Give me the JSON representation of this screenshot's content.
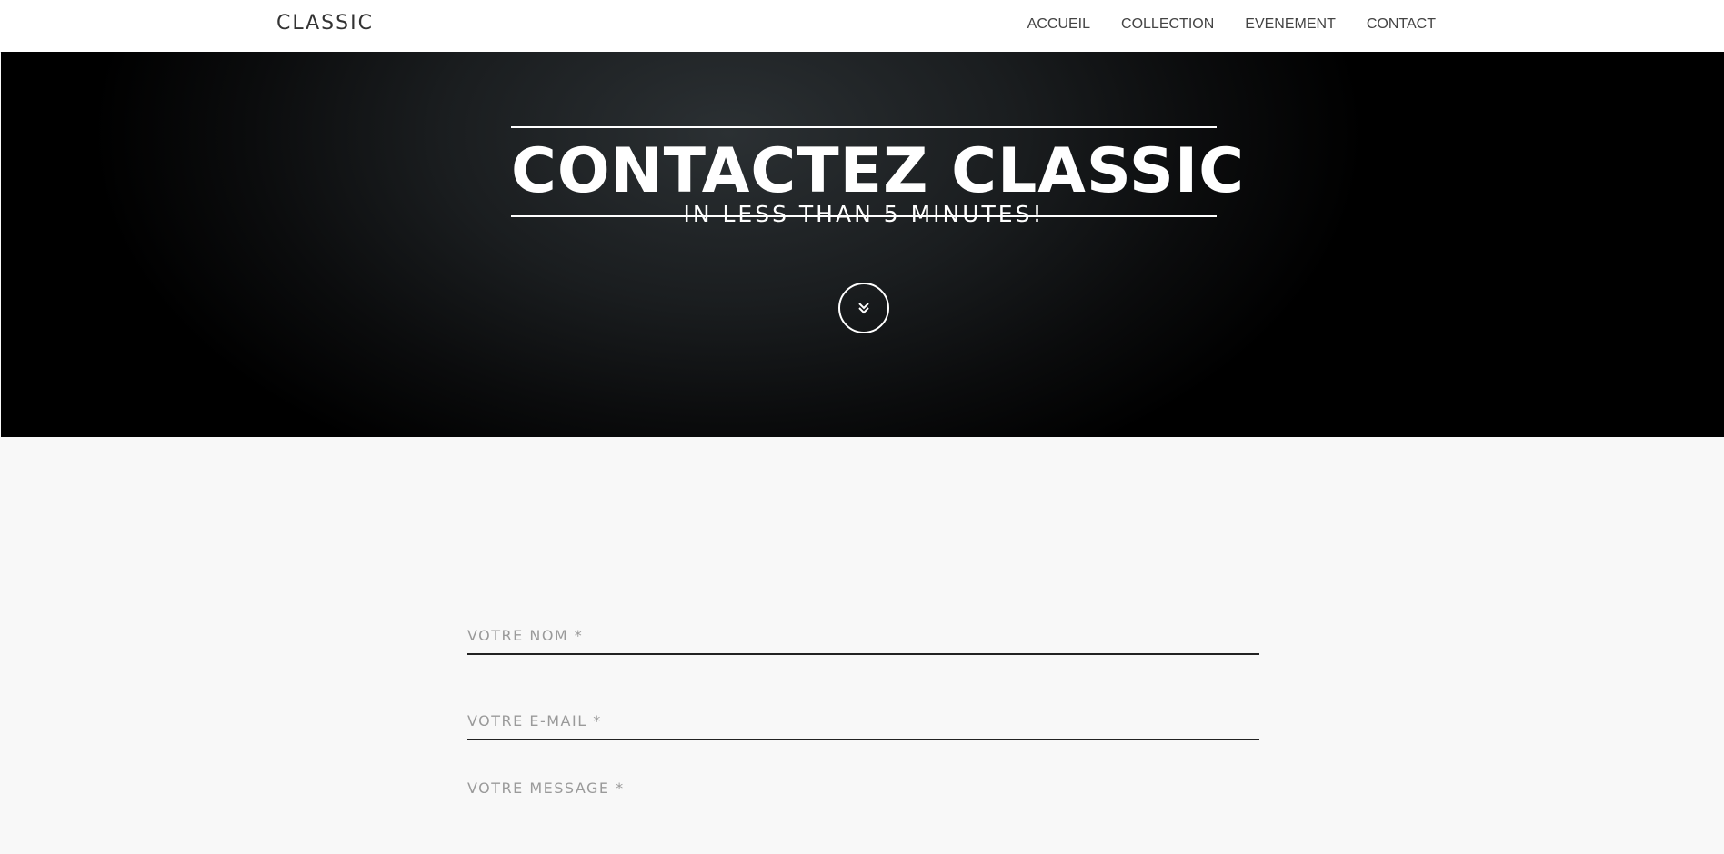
{
  "navbar": {
    "brand": "CLASSIC",
    "items": [
      {
        "label": "ACCUEIL"
      },
      {
        "label": "COLLECTION"
      },
      {
        "label": "EVENEMENT"
      },
      {
        "label": "CONTACT"
      }
    ]
  },
  "hero": {
    "title": "CONTACTEZ CLASSIC",
    "subtitle": "IN LESS THAN 5 MINUTES!",
    "scroll_icon": "double-chevron-down-icon"
  },
  "form": {
    "name_placeholder": "VOTRE NOM *",
    "email_placeholder": "VOTRE E-MAIL *",
    "message_placeholder": "VOTRE MESSAGE *"
  },
  "colors": {
    "navbar_bg": "#ffffff",
    "hero_bg": "#1a1d1f",
    "page_bg": "#f8f8f8",
    "text_light": "#ffffff",
    "field_line": "#222222"
  }
}
